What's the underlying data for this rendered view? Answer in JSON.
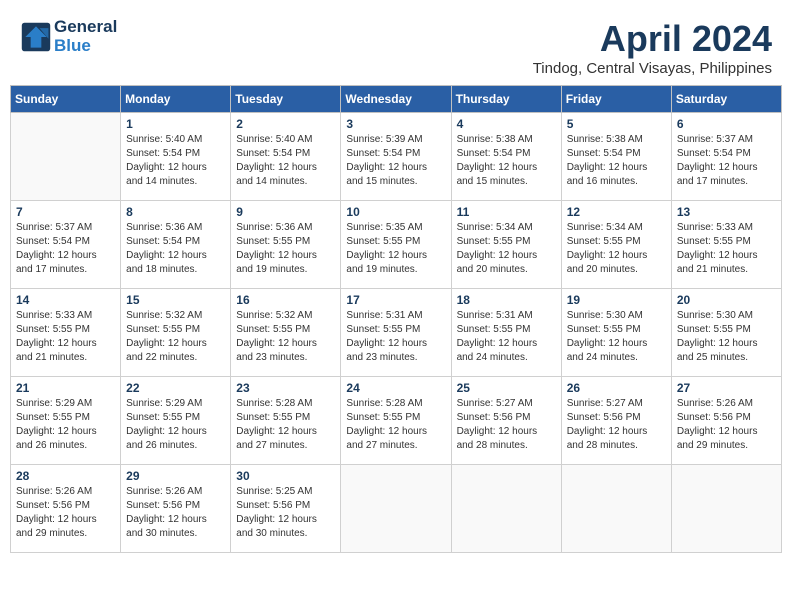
{
  "header": {
    "logo_line1": "General",
    "logo_line2": "Blue",
    "month_title": "April 2024",
    "location": "Tindog, Central Visayas, Philippines"
  },
  "days_of_week": [
    "Sunday",
    "Monday",
    "Tuesday",
    "Wednesday",
    "Thursday",
    "Friday",
    "Saturday"
  ],
  "weeks": [
    [
      {
        "day": "",
        "info": ""
      },
      {
        "day": "1",
        "info": "Sunrise: 5:40 AM\nSunset: 5:54 PM\nDaylight: 12 hours\nand 14 minutes."
      },
      {
        "day": "2",
        "info": "Sunrise: 5:40 AM\nSunset: 5:54 PM\nDaylight: 12 hours\nand 14 minutes."
      },
      {
        "day": "3",
        "info": "Sunrise: 5:39 AM\nSunset: 5:54 PM\nDaylight: 12 hours\nand 15 minutes."
      },
      {
        "day": "4",
        "info": "Sunrise: 5:38 AM\nSunset: 5:54 PM\nDaylight: 12 hours\nand 15 minutes."
      },
      {
        "day": "5",
        "info": "Sunrise: 5:38 AM\nSunset: 5:54 PM\nDaylight: 12 hours\nand 16 minutes."
      },
      {
        "day": "6",
        "info": "Sunrise: 5:37 AM\nSunset: 5:54 PM\nDaylight: 12 hours\nand 17 minutes."
      }
    ],
    [
      {
        "day": "7",
        "info": "Sunrise: 5:37 AM\nSunset: 5:54 PM\nDaylight: 12 hours\nand 17 minutes."
      },
      {
        "day": "8",
        "info": "Sunrise: 5:36 AM\nSunset: 5:54 PM\nDaylight: 12 hours\nand 18 minutes."
      },
      {
        "day": "9",
        "info": "Sunrise: 5:36 AM\nSunset: 5:55 PM\nDaylight: 12 hours\nand 19 minutes."
      },
      {
        "day": "10",
        "info": "Sunrise: 5:35 AM\nSunset: 5:55 PM\nDaylight: 12 hours\nand 19 minutes."
      },
      {
        "day": "11",
        "info": "Sunrise: 5:34 AM\nSunset: 5:55 PM\nDaylight: 12 hours\nand 20 minutes."
      },
      {
        "day": "12",
        "info": "Sunrise: 5:34 AM\nSunset: 5:55 PM\nDaylight: 12 hours\nand 20 minutes."
      },
      {
        "day": "13",
        "info": "Sunrise: 5:33 AM\nSunset: 5:55 PM\nDaylight: 12 hours\nand 21 minutes."
      }
    ],
    [
      {
        "day": "14",
        "info": "Sunrise: 5:33 AM\nSunset: 5:55 PM\nDaylight: 12 hours\nand 21 minutes."
      },
      {
        "day": "15",
        "info": "Sunrise: 5:32 AM\nSunset: 5:55 PM\nDaylight: 12 hours\nand 22 minutes."
      },
      {
        "day": "16",
        "info": "Sunrise: 5:32 AM\nSunset: 5:55 PM\nDaylight: 12 hours\nand 23 minutes."
      },
      {
        "day": "17",
        "info": "Sunrise: 5:31 AM\nSunset: 5:55 PM\nDaylight: 12 hours\nand 23 minutes."
      },
      {
        "day": "18",
        "info": "Sunrise: 5:31 AM\nSunset: 5:55 PM\nDaylight: 12 hours\nand 24 minutes."
      },
      {
        "day": "19",
        "info": "Sunrise: 5:30 AM\nSunset: 5:55 PM\nDaylight: 12 hours\nand 24 minutes."
      },
      {
        "day": "20",
        "info": "Sunrise: 5:30 AM\nSunset: 5:55 PM\nDaylight: 12 hours\nand 25 minutes."
      }
    ],
    [
      {
        "day": "21",
        "info": "Sunrise: 5:29 AM\nSunset: 5:55 PM\nDaylight: 12 hours\nand 26 minutes."
      },
      {
        "day": "22",
        "info": "Sunrise: 5:29 AM\nSunset: 5:55 PM\nDaylight: 12 hours\nand 26 minutes."
      },
      {
        "day": "23",
        "info": "Sunrise: 5:28 AM\nSunset: 5:55 PM\nDaylight: 12 hours\nand 27 minutes."
      },
      {
        "day": "24",
        "info": "Sunrise: 5:28 AM\nSunset: 5:55 PM\nDaylight: 12 hours\nand 27 minutes."
      },
      {
        "day": "25",
        "info": "Sunrise: 5:27 AM\nSunset: 5:56 PM\nDaylight: 12 hours\nand 28 minutes."
      },
      {
        "day": "26",
        "info": "Sunrise: 5:27 AM\nSunset: 5:56 PM\nDaylight: 12 hours\nand 28 minutes."
      },
      {
        "day": "27",
        "info": "Sunrise: 5:26 AM\nSunset: 5:56 PM\nDaylight: 12 hours\nand 29 minutes."
      }
    ],
    [
      {
        "day": "28",
        "info": "Sunrise: 5:26 AM\nSunset: 5:56 PM\nDaylight: 12 hours\nand 29 minutes."
      },
      {
        "day": "29",
        "info": "Sunrise: 5:26 AM\nSunset: 5:56 PM\nDaylight: 12 hours\nand 30 minutes."
      },
      {
        "day": "30",
        "info": "Sunrise: 5:25 AM\nSunset: 5:56 PM\nDaylight: 12 hours\nand 30 minutes."
      },
      {
        "day": "",
        "info": ""
      },
      {
        "day": "",
        "info": ""
      },
      {
        "day": "",
        "info": ""
      },
      {
        "day": "",
        "info": ""
      }
    ]
  ]
}
